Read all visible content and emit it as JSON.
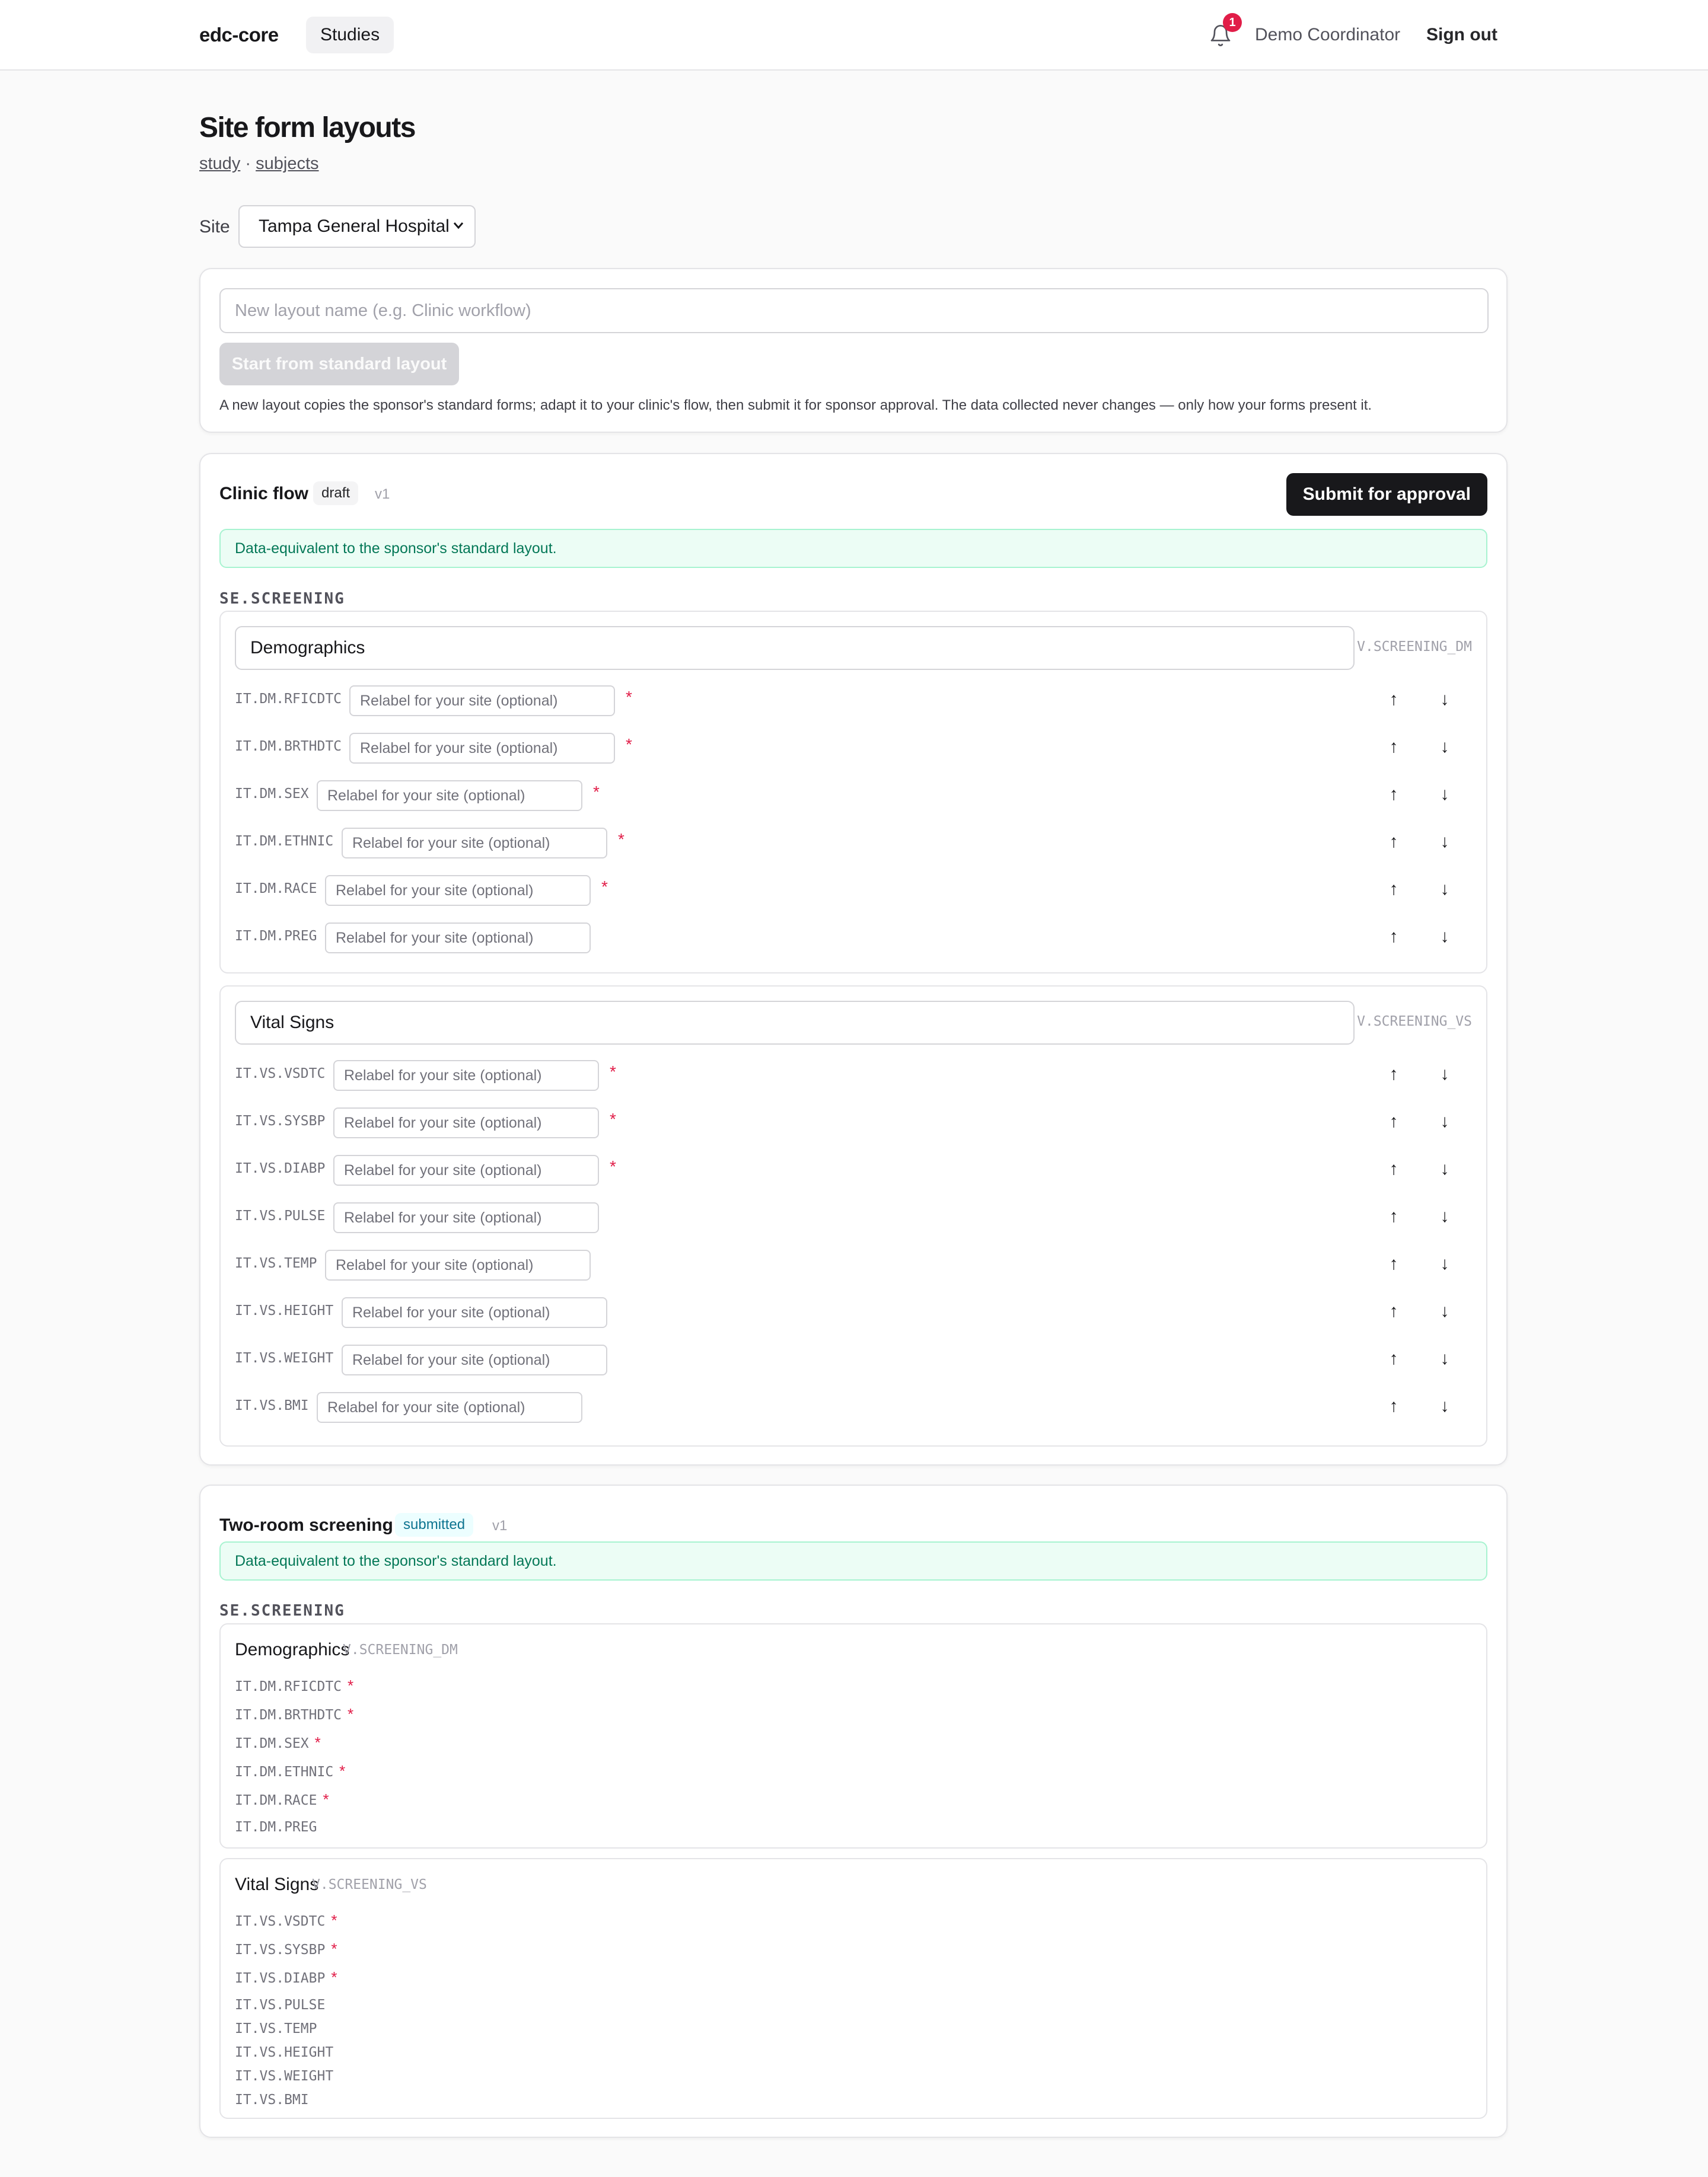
{
  "nav": {
    "brand": "edc-core",
    "studies": "Studies",
    "notifications_count": "1",
    "user": "Demo Coordinator",
    "sign_out": "Sign out"
  },
  "page": {
    "title": "Site form layouts",
    "crumb_study": "study",
    "crumb_sep": "·",
    "crumb_subjects": "subjects",
    "site_label": "Site",
    "site_selected": "Tampa General Hospital"
  },
  "new_layout": {
    "placeholder": "New layout name (e.g. Clinic workflow)",
    "button": "Start from standard layout",
    "help": "A new layout copies the sponsor's standard forms; adapt it to your clinic's flow, then submit it for sponsor approval. The data collected never changes — only how your forms present it."
  },
  "relabel_placeholder": "Relabel for your site (optional)",
  "required_mark": "*",
  "arrow_up": "↑",
  "arrow_down": "↓",
  "layouts": [
    {
      "name": "Clinic flow",
      "status": "draft",
      "version": "v1",
      "action": "Submit for approval",
      "notice": "Data-equivalent to the sponsor's standard layout.",
      "event": "SE.SCREENING",
      "forms": [
        {
          "title": "Demographics",
          "oid": "V.SCREENING_DM",
          "items": [
            {
              "oid": "IT.DM.RFICDTC",
              "required": true
            },
            {
              "oid": "IT.DM.BRTHDTC",
              "required": true
            },
            {
              "oid": "IT.DM.SEX",
              "required": true
            },
            {
              "oid": "IT.DM.ETHNIC",
              "required": true
            },
            {
              "oid": "IT.DM.RACE",
              "required": true
            },
            {
              "oid": "IT.DM.PREG",
              "required": false
            }
          ]
        },
        {
          "title": "Vital Signs",
          "oid": "V.SCREENING_VS",
          "items": [
            {
              "oid": "IT.VS.VSDTC",
              "required": true
            },
            {
              "oid": "IT.VS.SYSBP",
              "required": true
            },
            {
              "oid": "IT.VS.DIABP",
              "required": true
            },
            {
              "oid": "IT.VS.PULSE",
              "required": false
            },
            {
              "oid": "IT.VS.TEMP",
              "required": false
            },
            {
              "oid": "IT.VS.HEIGHT",
              "required": false
            },
            {
              "oid": "IT.VS.WEIGHT",
              "required": false
            },
            {
              "oid": "IT.VS.BMI",
              "required": false
            }
          ]
        }
      ]
    },
    {
      "name": "Two-room screening",
      "status": "submitted",
      "version": "v1",
      "notice": "Data-equivalent to the sponsor's standard layout.",
      "event": "SE.SCREENING",
      "forms": [
        {
          "title": "Demographics",
          "oid": "V.SCREENING_DM",
          "items": [
            {
              "oid": "IT.DM.RFICDTC",
              "required": true
            },
            {
              "oid": "IT.DM.BRTHDTC",
              "required": true
            },
            {
              "oid": "IT.DM.SEX",
              "required": true
            },
            {
              "oid": "IT.DM.ETHNIC",
              "required": true
            },
            {
              "oid": "IT.DM.RACE",
              "required": true
            },
            {
              "oid": "IT.DM.PREG",
              "required": false
            }
          ]
        },
        {
          "title": "Vital Signs",
          "oid": "V.SCREENING_VS",
          "items": [
            {
              "oid": "IT.VS.VSDTC",
              "required": true
            },
            {
              "oid": "IT.VS.SYSBP",
              "required": true
            },
            {
              "oid": "IT.VS.DIABP",
              "required": true
            },
            {
              "oid": "IT.VS.PULSE",
              "required": false
            },
            {
              "oid": "IT.VS.TEMP",
              "required": false
            },
            {
              "oid": "IT.VS.HEIGHT",
              "required": false
            },
            {
              "oid": "IT.VS.WEIGHT",
              "required": false
            },
            {
              "oid": "IT.VS.BMI",
              "required": false
            }
          ]
        }
      ]
    }
  ]
}
